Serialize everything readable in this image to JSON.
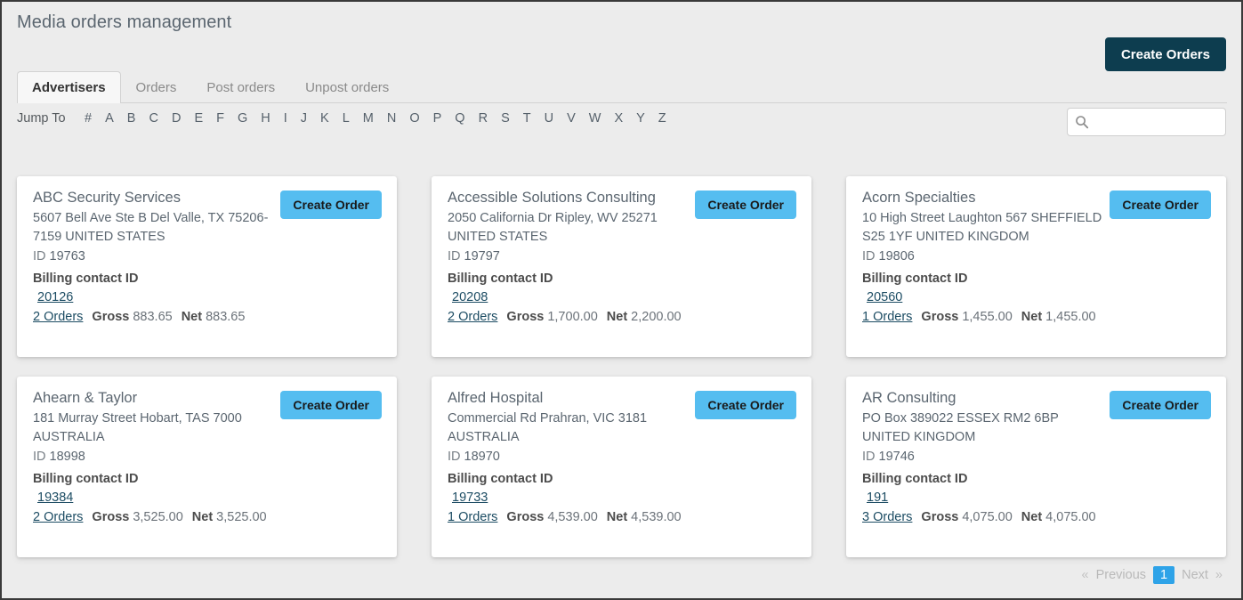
{
  "header": {
    "title": "Media orders management",
    "create_orders_label": "Create Orders"
  },
  "tabs": [
    {
      "label": "Advertisers",
      "active": true
    },
    {
      "label": "Orders",
      "active": false
    },
    {
      "label": "Post orders",
      "active": false
    },
    {
      "label": "Unpost orders",
      "active": false
    }
  ],
  "jump_to": {
    "label": "Jump To",
    "letters": [
      "#",
      "A",
      "B",
      "C",
      "D",
      "E",
      "F",
      "G",
      "H",
      "I",
      "J",
      "K",
      "L",
      "M",
      "N",
      "O",
      "P",
      "Q",
      "R",
      "S",
      "T",
      "U",
      "V",
      "W",
      "X",
      "Y",
      "Z"
    ]
  },
  "search": {
    "icon": "search-icon",
    "value": "",
    "placeholder": ""
  },
  "labels": {
    "id_prefix": "ID",
    "billing_contact": "Billing contact ID",
    "gross": "Gross",
    "net": "Net",
    "create_order": "Create Order"
  },
  "cards": [
    {
      "name": "ABC Security Services",
      "address": "5607 Bell Ave Ste B Del Valle, TX 75206-7159 UNITED STATES",
      "id": "19763",
      "billing_contact_id": "20126",
      "orders_link": "2 Orders",
      "gross": "883.65",
      "net": "883.65"
    },
    {
      "name": "Accessible Solutions Consulting",
      "address": "2050 California Dr Ripley, WV 25271 UNITED STATES",
      "id": "19797",
      "billing_contact_id": "20208",
      "orders_link": "2 Orders",
      "gross": "1,700.00",
      "net": "2,200.00"
    },
    {
      "name": "Acorn Specialties",
      "address": "10 High Street Laughton 567 SHEFFIELD S25 1YF UNITED KINGDOM",
      "id": "19806",
      "billing_contact_id": "20560",
      "orders_link": "1 Orders",
      "gross": "1,455.00",
      "net": "1,455.00"
    },
    {
      "name": "Ahearn & Taylor",
      "address": "181 Murray Street Hobart, TAS 7000 AUSTRALIA",
      "id": "18998",
      "billing_contact_id": "19384",
      "orders_link": "2 Orders",
      "gross": "3,525.00",
      "net": "3,525.00"
    },
    {
      "name": "Alfred Hospital",
      "address": "Commercial Rd Prahran, VIC 3181 AUSTRALIA",
      "id": "18970",
      "billing_contact_id": "19733",
      "orders_link": "1 Orders",
      "gross": "4,539.00",
      "net": "4,539.00"
    },
    {
      "name": "AR Consulting",
      "address": "PO Box 389022 ESSEX RM2 6BP UNITED KINGDOM",
      "id": "19746",
      "billing_contact_id": "191",
      "orders_link": "3 Orders",
      "gross": "4,075.00",
      "net": "4,075.00"
    }
  ],
  "pagination": {
    "prev_arrow": "«",
    "prev_label": "Previous",
    "current_page": "1",
    "next_label": "Next",
    "next_arrow": "»"
  },
  "colors": {
    "accent_dark": "#0d3d4f",
    "accent_light": "#55bdf0",
    "page_active": "#2ea3e8",
    "link": "#1c4c63",
    "background": "#ececec"
  }
}
